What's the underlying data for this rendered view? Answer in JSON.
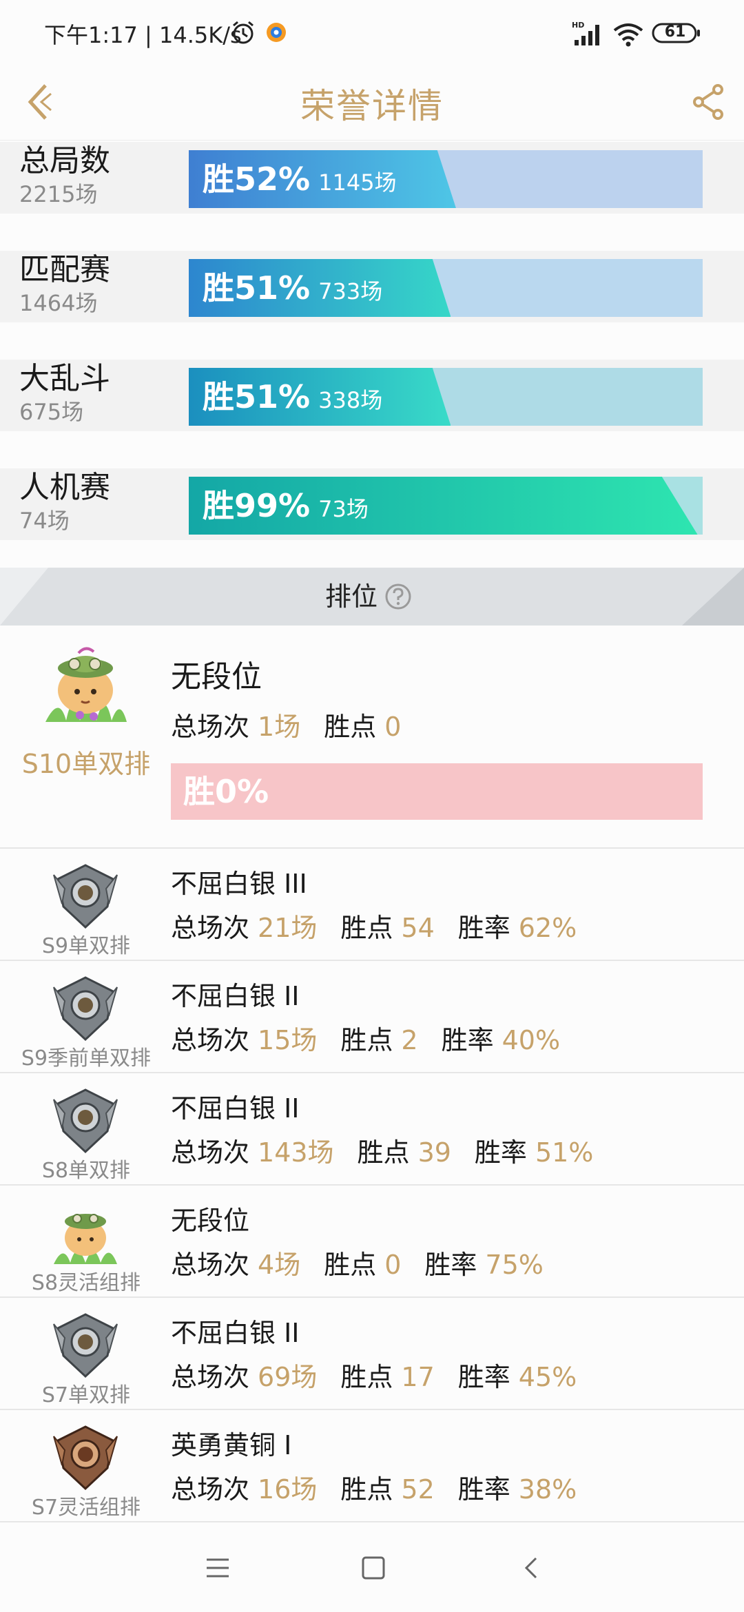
{
  "status_bar": {
    "time_text": "下午1:17 | 14.5K/s",
    "battery": "61"
  },
  "header": {
    "title": "荣誉详情"
  },
  "modes": [
    {
      "name": "总局数",
      "count": "2215场",
      "win_pct_label": "胜52%",
      "win_games": "1145场",
      "win_fraction": 0.52,
      "fill_from": "#3f7fd2",
      "fill_to": "#4ec6e6",
      "track_color": "#bcd2ee"
    },
    {
      "name": "匹配赛",
      "count": "1464场",
      "win_pct_label": "胜51%",
      "win_games": "733场",
      "win_fraction": 0.51,
      "fill_from": "#2d86cf",
      "fill_to": "#36d7c8",
      "track_color": "#bad8ef"
    },
    {
      "name": "大乱斗",
      "count": "675场",
      "win_pct_label": "胜51%",
      "win_games": "338场",
      "win_fraction": 0.51,
      "fill_from": "#1b8fbf",
      "fill_to": "#39dbc8",
      "track_color": "#aedbe6"
    },
    {
      "name": "人机赛",
      "count": "74场",
      "win_pct_label": "胜99%",
      "win_games": "73场",
      "win_fraction": 0.99,
      "fill_from": "#14a7a6",
      "fill_to": "#2ee5b0",
      "track_color": "#a9e1e3"
    }
  ],
  "ranked": {
    "title": "排位",
    "current": {
      "season": "S10单双排",
      "rank": "无段位",
      "games_label": "总场次",
      "games": "1场",
      "points_label": "胜点",
      "points": "0",
      "win_label": "胜0%"
    },
    "history": [
      {
        "season": "S9单双排",
        "rank": "不屈白银 III",
        "games_label": "总场次",
        "games": "21场",
        "points_label": "胜点",
        "points": "54",
        "rate_label": "胜率",
        "rate": "62%",
        "badge": "silver"
      },
      {
        "season": "S9季前单双排",
        "rank": "不屈白银 II",
        "games_label": "总场次",
        "games": "15场",
        "points_label": "胜点",
        "points": "2",
        "rate_label": "胜率",
        "rate": "40%",
        "badge": "silver"
      },
      {
        "season": "S8单双排",
        "rank": "不屈白银 II",
        "games_label": "总场次",
        "games": "143场",
        "points_label": "胜点",
        "points": "39",
        "rate_label": "胜率",
        "rate": "51%",
        "badge": "silver"
      },
      {
        "season": "S8灵活组排",
        "rank": "无段位",
        "games_label": "总场次",
        "games": "4场",
        "points_label": "胜点",
        "points": "0",
        "rate_label": "胜率",
        "rate": "75%",
        "badge": "teemo"
      },
      {
        "season": "S7单双排",
        "rank": "不屈白银 II",
        "games_label": "总场次",
        "games": "69场",
        "points_label": "胜点",
        "points": "17",
        "rate_label": "胜率",
        "rate": "45%",
        "badge": "silver"
      },
      {
        "season": "S7灵活组排",
        "rank": "英勇黄铜 I",
        "games_label": "总场次",
        "games": "16场",
        "points_label": "胜点",
        "points": "52",
        "rate_label": "胜率",
        "rate": "38%",
        "badge": "bronze"
      }
    ]
  },
  "icons": {
    "back": "back-arrow-icon",
    "share": "share-icon",
    "help": "question-icon",
    "alarm": "alarm-clock-icon",
    "signal": "signal-icon",
    "wifi": "wifi-icon",
    "battery": "battery-icon",
    "silver_badge": "silver-rank-badge-icon",
    "bronze_badge": "bronze-rank-badge-icon",
    "teemo": "teemo-avatar-icon"
  },
  "colors": {
    "accent_gold": "#c6a26a",
    "loss_pink": "#f7c5c8"
  }
}
